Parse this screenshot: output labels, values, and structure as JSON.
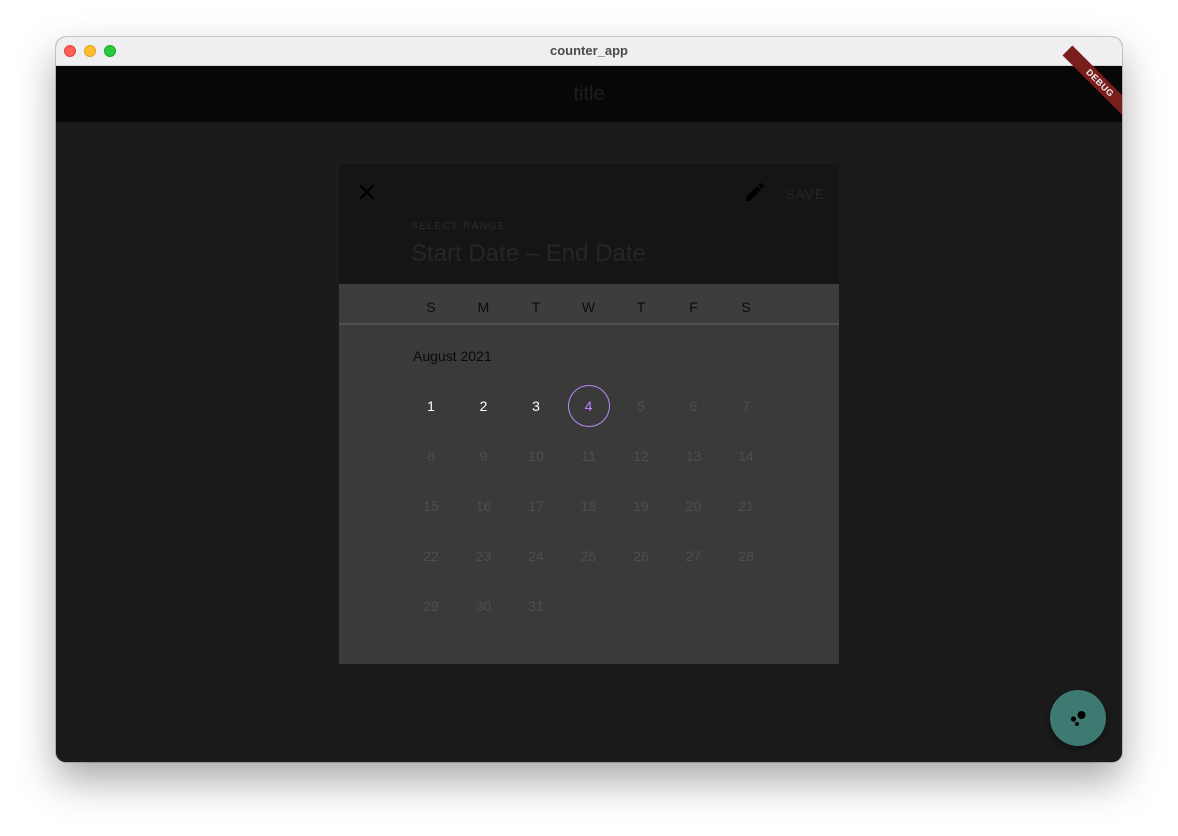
{
  "window": {
    "title": "counter_app"
  },
  "appbar": {
    "title": "title",
    "debug_label": "DEBUG"
  },
  "dialog": {
    "save_label": "SAVE",
    "select_range_label": "SELECT RANGE",
    "range_placeholder": "Start Date – End Date",
    "weekdays": [
      "S",
      "M",
      "T",
      "W",
      "T",
      "F",
      "S"
    ],
    "month_label": "August 2021",
    "days": [
      "1",
      "2",
      "3",
      "4",
      "5",
      "6",
      "7",
      "8",
      "9",
      "10",
      "11",
      "12",
      "13",
      "14",
      "15",
      "16",
      "17",
      "18",
      "19",
      "20",
      "21",
      "22",
      "23",
      "24",
      "25",
      "26",
      "27",
      "28",
      "29",
      "30",
      "31"
    ],
    "enabled_days": [
      "1",
      "2",
      "3",
      "4"
    ],
    "today": "4",
    "first_weekday_index": 0
  },
  "icons": {
    "close": "close-icon",
    "edit": "pencil-icon",
    "fab": "bubbles-icon"
  },
  "colors": {
    "accent": "#bb86fc",
    "fab": "#3d7a72",
    "debug_banner": "#7a1d1d"
  }
}
